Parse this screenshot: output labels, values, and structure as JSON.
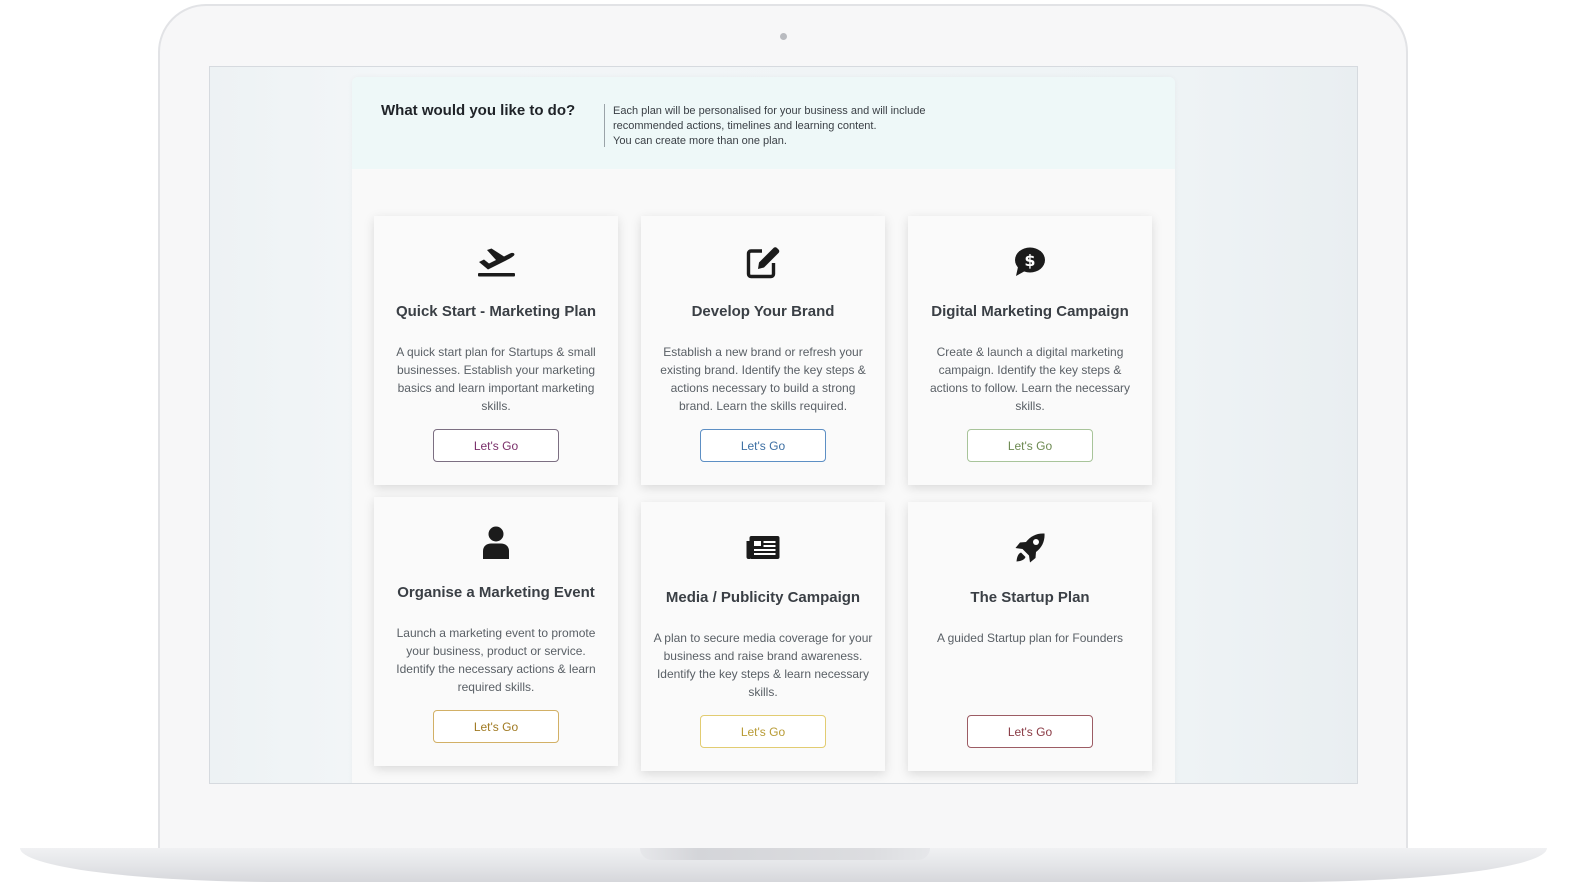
{
  "header": {
    "title": "What would you like to do?",
    "intro_lines": [
      "Each plan will be personalised for your business and will include",
      "recommended actions, timelines and learning content.",
      "You can create more than one plan."
    ]
  },
  "colors": {
    "button_border_1": "#7c6f82",
    "button_text_1": "#7a2f6a",
    "button_border_2": "#5d8fc4",
    "button_text_2": "#3d6fa3",
    "button_border_3": "#a8c49a",
    "button_text_3": "#6d8a52",
    "button_border_4": "#d2b066",
    "button_text_4": "#a07a22",
    "button_border_5": "#e2cc72",
    "button_text_5": "#b89b35",
    "button_border_6": "#9c5c64",
    "button_text_6": "#8a3b45"
  },
  "cards": [
    {
      "icon": "plane-takeoff-icon",
      "title": "Quick Start - Marketing Plan",
      "description": "A quick start plan for Startups & small businesses. Establish your marketing basics and learn important marketing skills.",
      "button": "Let's Go"
    },
    {
      "icon": "edit-icon",
      "title": "Develop Your Brand",
      "description": "Establish a new brand or refresh your existing brand. Identify the key steps & actions necessary to build a strong brand. Learn the skills required.",
      "button": "Let's Go"
    },
    {
      "icon": "dollar-chat-icon",
      "title": "Digital Marketing Campaign",
      "description": "Create & launch a digital marketing campaign. Identify the key steps & actions to follow. Learn the necessary skills.",
      "button": "Let's Go"
    },
    {
      "icon": "person-icon",
      "title": "Organise a Marketing Event",
      "description": "Launch a marketing event to promote your business, product or service. Identify the necessary actions & learn required skills.",
      "button": "Let's Go"
    },
    {
      "icon": "newspaper-icon",
      "title": "Media / Publicity Campaign",
      "description": "A plan to secure media coverage for your business and raise brand awareness. Identify the key steps & learn necessary skills.",
      "button": "Let's Go"
    },
    {
      "icon": "rocket-icon",
      "title": "The Startup Plan",
      "description": "A guided Startup plan for Founders",
      "button": "Let's Go"
    }
  ]
}
